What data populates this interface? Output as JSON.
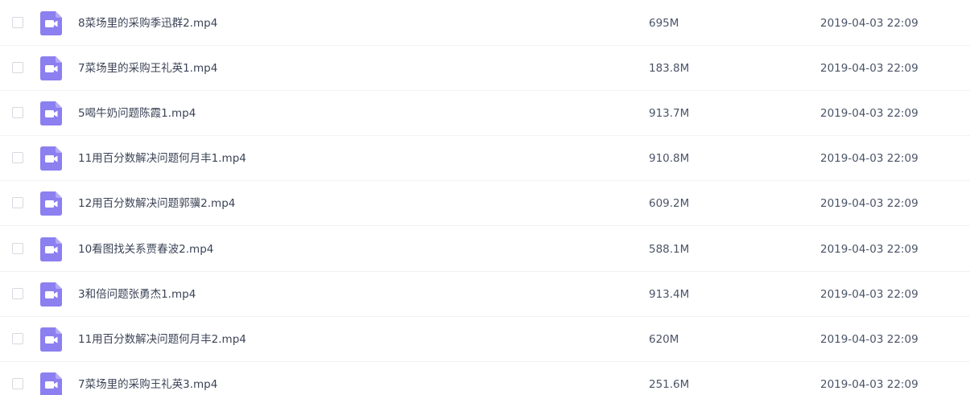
{
  "file_list": {
    "rows": [
      {
        "name": "8菜场里的采购季迅群2.mp4",
        "size": "695M",
        "date": "2019-04-03 22:09",
        "icon": "video-file-icon"
      },
      {
        "name": "7菜场里的采购王礼英1.mp4",
        "size": "183.8M",
        "date": "2019-04-03 22:09",
        "icon": "video-file-icon"
      },
      {
        "name": "5喝牛奶问题陈霞1.mp4",
        "size": "913.7M",
        "date": "2019-04-03 22:09",
        "icon": "video-file-icon"
      },
      {
        "name": "11用百分数解决问题何月丰1.mp4",
        "size": "910.8M",
        "date": "2019-04-03 22:09",
        "icon": "video-file-icon"
      },
      {
        "name": "12用百分数解决问题郭骥2.mp4",
        "size": "609.2M",
        "date": "2019-04-03 22:09",
        "icon": "video-file-icon"
      },
      {
        "name": "10看图找关系贾春波2.mp4",
        "size": "588.1M",
        "date": "2019-04-03 22:09",
        "icon": "video-file-icon"
      },
      {
        "name": "3和倍问题张勇杰1.mp4",
        "size": "913.4M",
        "date": "2019-04-03 22:09",
        "icon": "video-file-icon"
      },
      {
        "name": "11用百分数解决问题何月丰2.mp4",
        "size": "620M",
        "date": "2019-04-03 22:09",
        "icon": "video-file-icon"
      },
      {
        "name": "7菜场里的采购王礼英3.mp4",
        "size": "251.6M",
        "date": "2019-04-03 22:09",
        "icon": "video-file-icon"
      }
    ]
  },
  "colors": {
    "video_icon_bg": "#8c7ff0",
    "video_icon_fold": "#b3a9f7",
    "video_icon_glyph": "#ffffff"
  }
}
